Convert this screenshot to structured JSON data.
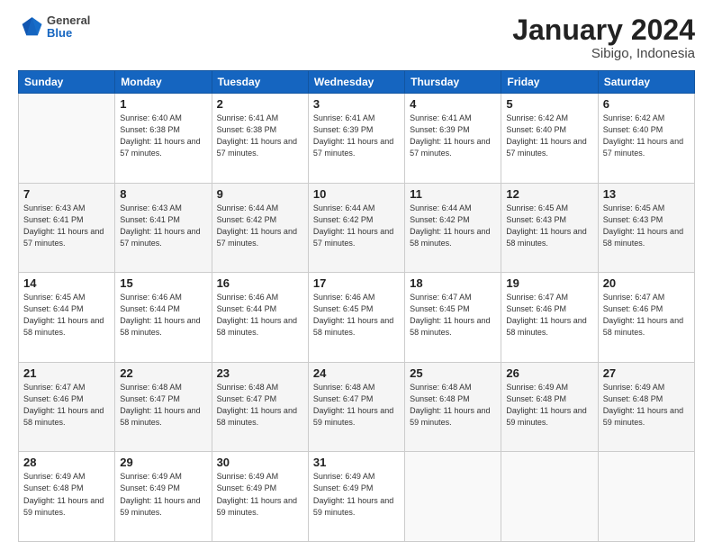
{
  "header": {
    "logo": {
      "general": "General",
      "blue": "Blue"
    },
    "title": "January 2024",
    "location": "Sibigo, Indonesia"
  },
  "weekdays": [
    "Sunday",
    "Monday",
    "Tuesday",
    "Wednesday",
    "Thursday",
    "Friday",
    "Saturday"
  ],
  "weeks": [
    [
      {
        "day": null
      },
      {
        "day": 1,
        "sunrise": "6:40 AM",
        "sunset": "6:38 PM",
        "daylight": "11 hours and 57 minutes."
      },
      {
        "day": 2,
        "sunrise": "6:41 AM",
        "sunset": "6:38 PM",
        "daylight": "11 hours and 57 minutes."
      },
      {
        "day": 3,
        "sunrise": "6:41 AM",
        "sunset": "6:39 PM",
        "daylight": "11 hours and 57 minutes."
      },
      {
        "day": 4,
        "sunrise": "6:41 AM",
        "sunset": "6:39 PM",
        "daylight": "11 hours and 57 minutes."
      },
      {
        "day": 5,
        "sunrise": "6:42 AM",
        "sunset": "6:40 PM",
        "daylight": "11 hours and 57 minutes."
      },
      {
        "day": 6,
        "sunrise": "6:42 AM",
        "sunset": "6:40 PM",
        "daylight": "11 hours and 57 minutes."
      }
    ],
    [
      {
        "day": 7,
        "sunrise": "6:43 AM",
        "sunset": "6:41 PM",
        "daylight": "11 hours and 57 minutes."
      },
      {
        "day": 8,
        "sunrise": "6:43 AM",
        "sunset": "6:41 PM",
        "daylight": "11 hours and 57 minutes."
      },
      {
        "day": 9,
        "sunrise": "6:44 AM",
        "sunset": "6:42 PM",
        "daylight": "11 hours and 57 minutes."
      },
      {
        "day": 10,
        "sunrise": "6:44 AM",
        "sunset": "6:42 PM",
        "daylight": "11 hours and 57 minutes."
      },
      {
        "day": 11,
        "sunrise": "6:44 AM",
        "sunset": "6:42 PM",
        "daylight": "11 hours and 58 minutes."
      },
      {
        "day": 12,
        "sunrise": "6:45 AM",
        "sunset": "6:43 PM",
        "daylight": "11 hours and 58 minutes."
      },
      {
        "day": 13,
        "sunrise": "6:45 AM",
        "sunset": "6:43 PM",
        "daylight": "11 hours and 58 minutes."
      }
    ],
    [
      {
        "day": 14,
        "sunrise": "6:45 AM",
        "sunset": "6:44 PM",
        "daylight": "11 hours and 58 minutes."
      },
      {
        "day": 15,
        "sunrise": "6:46 AM",
        "sunset": "6:44 PM",
        "daylight": "11 hours and 58 minutes."
      },
      {
        "day": 16,
        "sunrise": "6:46 AM",
        "sunset": "6:44 PM",
        "daylight": "11 hours and 58 minutes."
      },
      {
        "day": 17,
        "sunrise": "6:46 AM",
        "sunset": "6:45 PM",
        "daylight": "11 hours and 58 minutes."
      },
      {
        "day": 18,
        "sunrise": "6:47 AM",
        "sunset": "6:45 PM",
        "daylight": "11 hours and 58 minutes."
      },
      {
        "day": 19,
        "sunrise": "6:47 AM",
        "sunset": "6:46 PM",
        "daylight": "11 hours and 58 minutes."
      },
      {
        "day": 20,
        "sunrise": "6:47 AM",
        "sunset": "6:46 PM",
        "daylight": "11 hours and 58 minutes."
      }
    ],
    [
      {
        "day": 21,
        "sunrise": "6:47 AM",
        "sunset": "6:46 PM",
        "daylight": "11 hours and 58 minutes."
      },
      {
        "day": 22,
        "sunrise": "6:48 AM",
        "sunset": "6:47 PM",
        "daylight": "11 hours and 58 minutes."
      },
      {
        "day": 23,
        "sunrise": "6:48 AM",
        "sunset": "6:47 PM",
        "daylight": "11 hours and 58 minutes."
      },
      {
        "day": 24,
        "sunrise": "6:48 AM",
        "sunset": "6:47 PM",
        "daylight": "11 hours and 59 minutes."
      },
      {
        "day": 25,
        "sunrise": "6:48 AM",
        "sunset": "6:48 PM",
        "daylight": "11 hours and 59 minutes."
      },
      {
        "day": 26,
        "sunrise": "6:49 AM",
        "sunset": "6:48 PM",
        "daylight": "11 hours and 59 minutes."
      },
      {
        "day": 27,
        "sunrise": "6:49 AM",
        "sunset": "6:48 PM",
        "daylight": "11 hours and 59 minutes."
      }
    ],
    [
      {
        "day": 28,
        "sunrise": "6:49 AM",
        "sunset": "6:48 PM",
        "daylight": "11 hours and 59 minutes."
      },
      {
        "day": 29,
        "sunrise": "6:49 AM",
        "sunset": "6:49 PM",
        "daylight": "11 hours and 59 minutes."
      },
      {
        "day": 30,
        "sunrise": "6:49 AM",
        "sunset": "6:49 PM",
        "daylight": "11 hours and 59 minutes."
      },
      {
        "day": 31,
        "sunrise": "6:49 AM",
        "sunset": "6:49 PM",
        "daylight": "11 hours and 59 minutes."
      },
      {
        "day": null
      },
      {
        "day": null
      },
      {
        "day": null
      }
    ]
  ]
}
